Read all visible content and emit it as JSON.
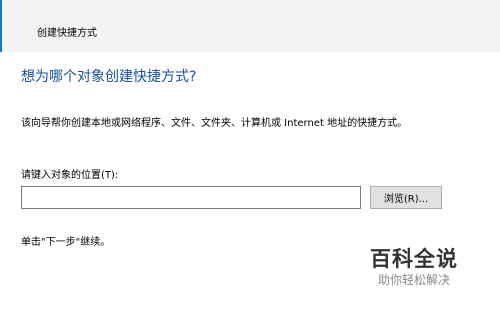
{
  "window": {
    "title": "创建快捷方式"
  },
  "main": {
    "heading": "想为哪个对象创建快捷方式?",
    "description": "该向导帮你创建本地或网络程序、文件、文件夹、计算机或 Internet 地址的快捷方式。",
    "location_label": "请键入对象的位置(T):",
    "location_value": "",
    "browse_label": "浏览(R)...",
    "hint": "单击\"下一步\"继续。"
  },
  "watermark": {
    "brand": "百科全说",
    "slogan": "助你轻松解决"
  },
  "colors": {
    "accent": "#0f7ad7",
    "heading": "#1a4fa0"
  }
}
